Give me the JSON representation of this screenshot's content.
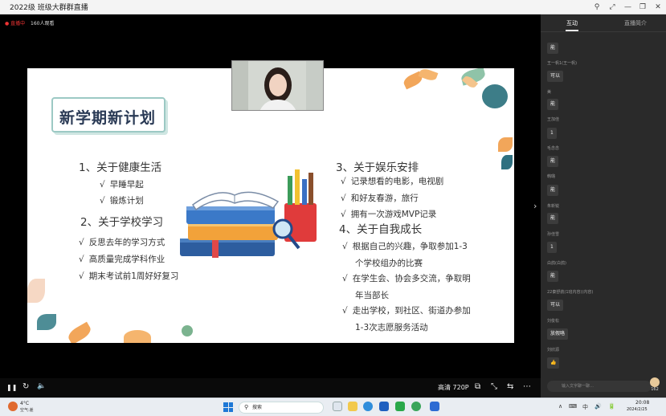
{
  "window": {
    "title": "2022级 班级大群群直播",
    "controls": [
      "⚲",
      "⤢",
      "—",
      "❐",
      "✕"
    ]
  },
  "stream": {
    "live_badge": "● 直播中",
    "viewers": "160人观看"
  },
  "slide": {
    "title": "新学期新计划",
    "sections": [
      {
        "title": "1、关于健康生活",
        "items": [
          "早睡早起",
          "锻炼计划"
        ]
      },
      {
        "title": "2、关于学校学习",
        "items": [
          "反思去年的学习方式",
          "高质量完成学科作业",
          "期末考试前1周好好复习"
        ]
      },
      {
        "title": "3、关于娱乐安排",
        "items": [
          "记录想看的电影，电视剧",
          "和好友春游，旅行",
          "拥有一次游戏MVP记录"
        ]
      },
      {
        "title": "4、关于自我成长",
        "items": [
          [
            "根据自己的兴趣，争取参加1-3",
            "个学校组办的比赛"
          ],
          [
            "在学生会、协会多交流，争取明",
            "年当部长"
          ],
          [
            "走出学校，到社区、街道办参加",
            "1-3次志愿服务活动"
          ]
        ]
      }
    ],
    "check_mark": "√"
  },
  "player": {
    "play_icon": "❚❚",
    "refresh_icon": "↻",
    "volume_icon": "🔈",
    "quality": "高清 720P",
    "icons": [
      "⧉",
      "⤡",
      "⇆",
      "⋯"
    ]
  },
  "panel": {
    "tabs": [
      "互动",
      "直播简介"
    ],
    "side_arrow": "›",
    "messages": [
      {
        "name": "",
        "text": "能"
      },
      {
        "name": "王一帆1(王一帆)",
        "text": "可以"
      },
      {
        "name": "美",
        "text": "能"
      },
      {
        "name": "王加佳",
        "text": "1"
      },
      {
        "name": "毛念念",
        "text": "能"
      },
      {
        "name": "韩璐",
        "text": "能"
      },
      {
        "name": "朱新锐",
        "text": "能"
      },
      {
        "name": "孙佳雪",
        "text": "1"
      },
      {
        "name": "白鸽(白鸽)",
        "text": "能"
      },
      {
        "name": "22秦舒航(1班内容)(内容)",
        "text": "可以"
      },
      {
        "name": "刘俊松",
        "text": "放假咯"
      },
      {
        "name": "刘欣源",
        "text": "👍"
      }
    ],
    "input_placeholder": "输入文字聊一聊…",
    "like_count": "162"
  },
  "taskbar": {
    "weather_temp": "4°C",
    "weather_desc": "空气:差",
    "search_placeholder": "搜索",
    "tray_icons": [
      "∧",
      "⌨",
      "中",
      "🔊",
      "🔋"
    ],
    "time": "20:08",
    "date": "2024/2/25",
    "app_colors": [
      "#1e6fd9",
      "#2f8ddb",
      "#0a7a3f",
      "#28a745",
      "#3aa55a",
      "#f2b632",
      "#2d6bd3",
      "#5a5a5a"
    ]
  }
}
